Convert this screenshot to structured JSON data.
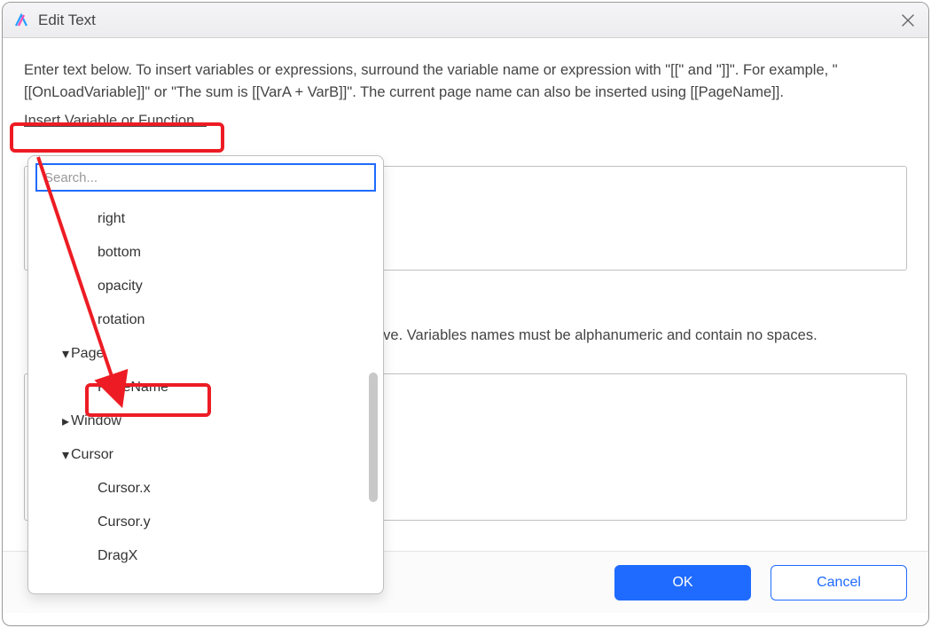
{
  "window": {
    "title": "Edit Text"
  },
  "instructions": "Enter text below. To insert variables or expressions, surround the variable name or expression with \"[[\" and \"]]\". For example, \"[[OnLoadVariable]]\" or \"The sum is [[VarA + VarB]]\". The current page name can also be inserted using [[PageName]].",
  "insert_link": "Insert Variable or Function...",
  "mid_text": "ove. Variables names must be alphanumeric and contain no spaces.",
  "buttons": {
    "ok": "OK",
    "cancel": "Cancel"
  },
  "dropdown": {
    "search_placeholder": "Search...",
    "items": [
      {
        "label": "right",
        "type": "item"
      },
      {
        "label": "bottom",
        "type": "item"
      },
      {
        "label": "opacity",
        "type": "item"
      },
      {
        "label": "rotation",
        "type": "item"
      },
      {
        "label": "Page",
        "type": "group",
        "expanded": true
      },
      {
        "label": "PageName",
        "type": "item"
      },
      {
        "label": "Window",
        "type": "group",
        "expanded": false
      },
      {
        "label": "Cursor",
        "type": "group",
        "expanded": true
      },
      {
        "label": "Cursor.x",
        "type": "item"
      },
      {
        "label": "Cursor.y",
        "type": "item"
      },
      {
        "label": "DragX",
        "type": "item"
      }
    ]
  }
}
